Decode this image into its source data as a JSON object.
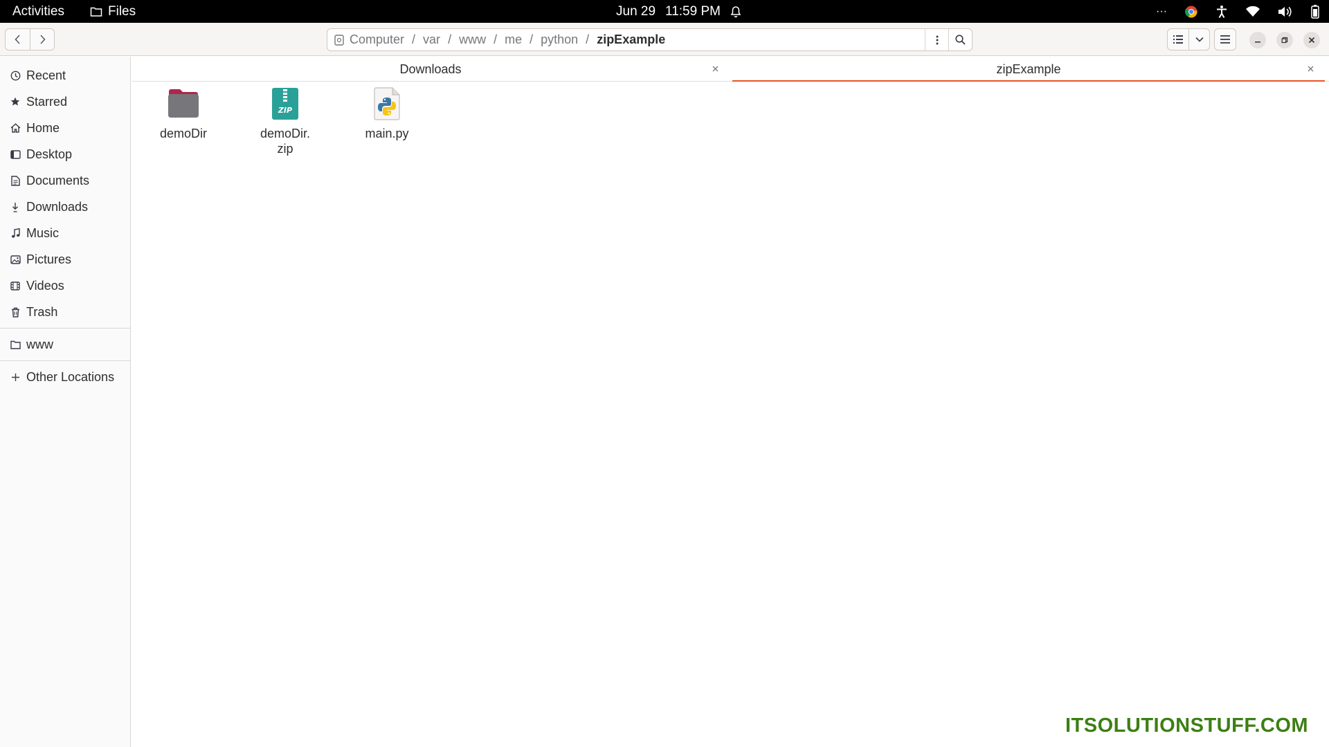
{
  "topbar": {
    "activities": "Activities",
    "app_name": "Files",
    "date": "Jun 29",
    "time": "11:59 PM",
    "overflow": "···"
  },
  "pathbar": {
    "crumbs": [
      "Computer",
      "var",
      "www",
      "me",
      "python"
    ],
    "current": "zipExample",
    "separator": "/"
  },
  "sidebar": {
    "items": [
      {
        "label": "Recent",
        "icon": "clock-icon"
      },
      {
        "label": "Starred",
        "icon": "star-icon"
      },
      {
        "label": "Home",
        "icon": "home-icon"
      },
      {
        "label": "Desktop",
        "icon": "desktop-icon"
      },
      {
        "label": "Documents",
        "icon": "document-icon"
      },
      {
        "label": "Downloads",
        "icon": "download-icon"
      },
      {
        "label": "Music",
        "icon": "music-icon"
      },
      {
        "label": "Pictures",
        "icon": "picture-icon"
      },
      {
        "label": "Videos",
        "icon": "video-icon"
      },
      {
        "label": "Trash",
        "icon": "trash-icon"
      }
    ],
    "bookmarks": [
      {
        "label": "www",
        "icon": "folder-icon"
      }
    ],
    "other_locations": "Other Locations"
  },
  "tabs": [
    {
      "label": "Downloads",
      "active": false
    },
    {
      "label": "zipExample",
      "active": true
    }
  ],
  "files": [
    {
      "name": "demoDir",
      "type": "folder",
      "icon": "folder-icon"
    },
    {
      "name": "demoDir.\nzip",
      "type": "zip",
      "icon": "zip-archive-icon",
      "badge": "ZIP"
    },
    {
      "name": "main.py",
      "type": "python",
      "icon": "python-file-icon"
    }
  ],
  "colors": {
    "accent": "#e95420",
    "folder": "#77767b",
    "folder_tab": "#b0254c",
    "zip": "#2aa198",
    "watermark": "#3c7f13"
  },
  "watermark": "ITSOLUTIONSTUFF.COM"
}
